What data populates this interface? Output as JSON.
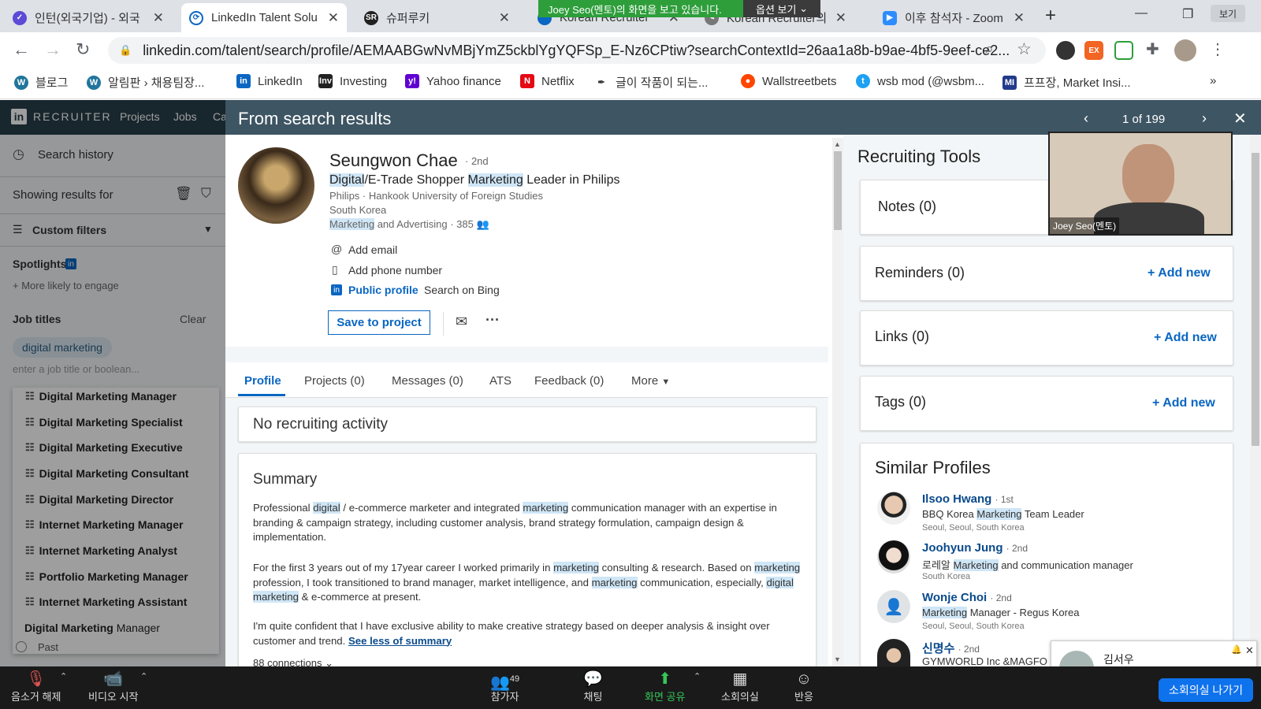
{
  "browser": {
    "tabs": [
      {
        "title": "인턴(외국기업) - 외국",
        "active": false
      },
      {
        "title": "LinkedIn Talent Solu",
        "active": true
      },
      {
        "title": "슈퍼루키",
        "active": false
      },
      {
        "title": "Korean Recruiter",
        "active": false
      },
      {
        "title": "Korean Recruiter의",
        "active": false
      },
      {
        "title": "이후 참석자 - Zoom",
        "active": false
      }
    ],
    "url": "linkedin.com/talent/search/profile/AEMAABGwNvMBjYmZ5ckblYgYQFSp_E-Nz6CPtiw?searchContextId=26aa1a8b-b9ae-4bf5-9eef-ce2...",
    "bookmarks": [
      "블로그",
      "알림판 › 채용팀장...",
      "LinkedIn",
      "Investing",
      "Yahoo finance",
      "Netflix",
      "글이 작품이 되는...",
      "Wallstreetbets",
      "wsb mod (@wsbm...",
      "프프장, Market Insi..."
    ],
    "more_bookmarks": "»",
    "icons": {
      "Ex_badge": "EX"
    }
  },
  "zoom_share_banner": "Joey Seo(멘토)의 화면을 보고 있습니다.",
  "zoom_options": "옵션 보기",
  "recruiter": {
    "logo_text": "RECRUITER",
    "nav": [
      "Projects",
      "Jobs",
      "Ca"
    ]
  },
  "sidebar": {
    "search_history": "Search history",
    "showing_results": "Showing results for",
    "custom_filters": "Custom filters",
    "spotlights": "Spotlights",
    "more_likely": "More likely to engage",
    "job_titles": "Job titles",
    "clear": "Clear",
    "chip": "digital marketing",
    "input_placeholder": "enter a job title or boolean...",
    "suggestions": [
      "Digital Marketing Manager",
      "Digital Marketing Specialist",
      "Digital Marketing Executive",
      "Digital Marketing Consultant",
      "Digital Marketing Director",
      "Internet Marketing Manager",
      "Internet Marketing Analyst",
      "Portfolio Marketing Manager",
      "Internet Marketing Assistant"
    ],
    "last_item_a": "Digital Marketing ",
    "last_item_b": "Manager",
    "past": "Past"
  },
  "modal": {
    "title": "From search results",
    "pager": "1 of 199",
    "profile": {
      "name": "Seungwon Chae",
      "degree": "· 2nd",
      "headline_parts": [
        "Digital",
        "/E-Trade Shopper ",
        "Marketing",
        " Leader in Philips"
      ],
      "education": "Philips · Hankook University of Foreign Studies",
      "location": "South Korea",
      "industry_hl": "Marketing",
      "industry_rest": " and Advertising · 385",
      "add_email": "Add email",
      "add_phone": "Add phone number",
      "public_profile": "Public profile",
      "search_bing": "Search on Bing",
      "save_button": "Save to project",
      "more": "···"
    },
    "tabs": [
      "Profile",
      "Projects (0)",
      "Messages (0)",
      "ATS",
      "Feedback (0)",
      "More"
    ],
    "no_activity": "No recruiting activity",
    "summary": {
      "title": "Summary",
      "p1": [
        "Professional ",
        "digital",
        " / e-commerce marketer and integrated ",
        "marketing",
        " communication manager with an expertise in branding & campaign strategy, including customer analysis, brand strategy formulation, campaign design & implementation."
      ],
      "p2": [
        "For the first 3 years out of my 17year career I worked primarily in ",
        "marketing",
        " consulting & research. Based on ",
        "marketing",
        " profession, I took transitioned to brand manager, market intelligence, and ",
        "marketing",
        " communication, especially, ",
        "digital marketing",
        " & e-commerce at present."
      ],
      "p3": "I'm quite confident that I have exclusive ability to make creative strategy based on deeper analysis & insight over customer and trend.",
      "see_less": "See less of summary",
      "connections": "88 connections"
    },
    "tools": {
      "title": "Recruiting Tools",
      "notes": "Notes (0)",
      "reminders": "Reminders (0)",
      "links": "Links (0)",
      "tags": "Tags (0)",
      "add_new": "+ Add new"
    },
    "similar": {
      "title": "Similar Profiles",
      "people": [
        {
          "name": "Ilsoo Hwang",
          "degree": "· 1st",
          "t1": "BBQ Korea ",
          "hl": "Marketing",
          "t2": " Team Leader",
          "loc": "Seoul, Seoul, South Korea"
        },
        {
          "name": "Joohyun Jung",
          "degree": "· 2nd",
          "t1": "로레알 ",
          "hl": "Marketing",
          "t2": " and communication manager",
          "loc": "South Korea"
        },
        {
          "name": "Wonje Choi",
          "degree": "· 2nd",
          "t1": "",
          "hl": "Marketing",
          "t2": " Manager - Regus Korea",
          "loc": "Seoul, Seoul, South Korea"
        },
        {
          "name": "신명수",
          "degree": "· 2nd",
          "t1": "GYMWORLD Inc &MAGFOR",
          "hl": "",
          "t2": "",
          "loc": ""
        }
      ]
    }
  },
  "video": {
    "label": "Joey Seo(멘토)"
  },
  "notification": {
    "name": "김서우"
  },
  "zoom": {
    "mute": "음소거 해제",
    "video": "비디오 시작",
    "participants": "참가자",
    "participant_count": "49",
    "chat": "채팅",
    "share": "화면 공유",
    "breakout": "소회의실",
    "reactions": "반응",
    "leave_breakout": "소회의실 나가기",
    "badge": "보기"
  }
}
